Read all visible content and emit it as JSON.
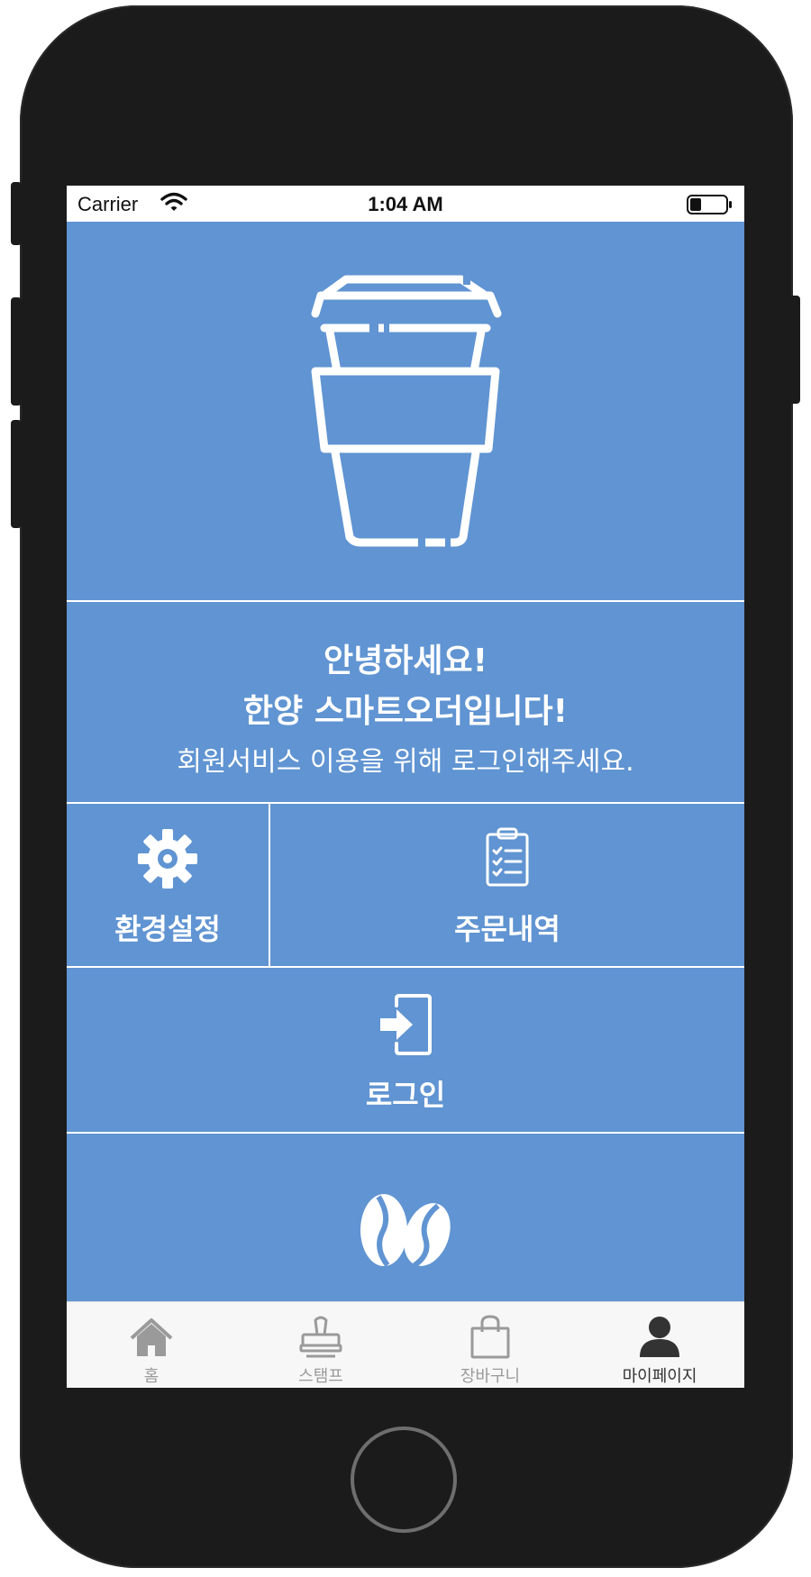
{
  "status_bar": {
    "carrier": "Carrier",
    "time": "1:04 AM"
  },
  "colors": {
    "screen_background": "#6094d2",
    "text": "#ffffff",
    "tabbar_background": "#f7f7f7",
    "tab_inactive": "#9a9a9a",
    "tab_active": "#333333"
  },
  "hero": {
    "icon": "coffee-cup-icon"
  },
  "welcome": {
    "line1": "안녕하세요!",
    "line2": "한양 스마트오더입니다!",
    "line3": "회원서비스 이용을 위해 로그인해주세요."
  },
  "menu": {
    "settings": {
      "label": "환경설정",
      "icon": "gear-icon"
    },
    "orders": {
      "label": "주문내역",
      "icon": "clipboard-icon"
    },
    "login": {
      "label": "로그인",
      "icon": "login-icon"
    }
  },
  "footer": {
    "icon": "coffee-beans-icon"
  },
  "tabbar": {
    "tabs": [
      {
        "label": "홈",
        "icon": "home-icon",
        "active": false
      },
      {
        "label": "스탬프",
        "icon": "stamp-icon",
        "active": false
      },
      {
        "label": "장바구니",
        "icon": "shopping-bag-icon",
        "active": false
      },
      {
        "label": "마이페이지",
        "icon": "user-icon",
        "active": true
      }
    ]
  }
}
